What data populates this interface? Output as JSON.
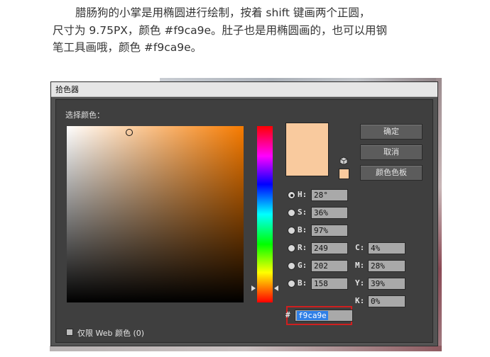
{
  "article": {
    "line1": "腊肠狗的小掌是用椭圆进行绘制，按着 shift 键画两个正圆，",
    "line2": "尺寸为 9.75PX，颜色 #f9ca9e。肚子也是用椭圆画的，也可以用钢",
    "line3": "笔工具画哦，颜色 #f9ca9e。"
  },
  "dialog": {
    "title": "拾色器",
    "pick_label": "选择颜色：",
    "field_color": "#f77b00",
    "new_color": "#f9ca9e",
    "buttons": {
      "ok": "确定",
      "cancel": "取消",
      "swatches": "颜色色板"
    },
    "hsb": {
      "h": {
        "label": "H:",
        "value": "28°"
      },
      "s": {
        "label": "S:",
        "value": "36%"
      },
      "b": {
        "label": "B:",
        "value": "97%"
      }
    },
    "rgb": {
      "r": {
        "label": "R:",
        "value": "249"
      },
      "g": {
        "label": "G:",
        "value": "202"
      },
      "b": {
        "label": "B:",
        "value": "158"
      }
    },
    "cmyk": {
      "c": {
        "label": "C:",
        "value": "4%"
      },
      "m": {
        "label": "M:",
        "value": "28%"
      },
      "y": {
        "label": "Y:",
        "value": "39%"
      },
      "k": {
        "label": "K:",
        "value": "0%"
      }
    },
    "hex": {
      "label": "#",
      "value": "f9ca9e"
    },
    "web_only_label": "仅限 Web 颜色 (0)"
  }
}
